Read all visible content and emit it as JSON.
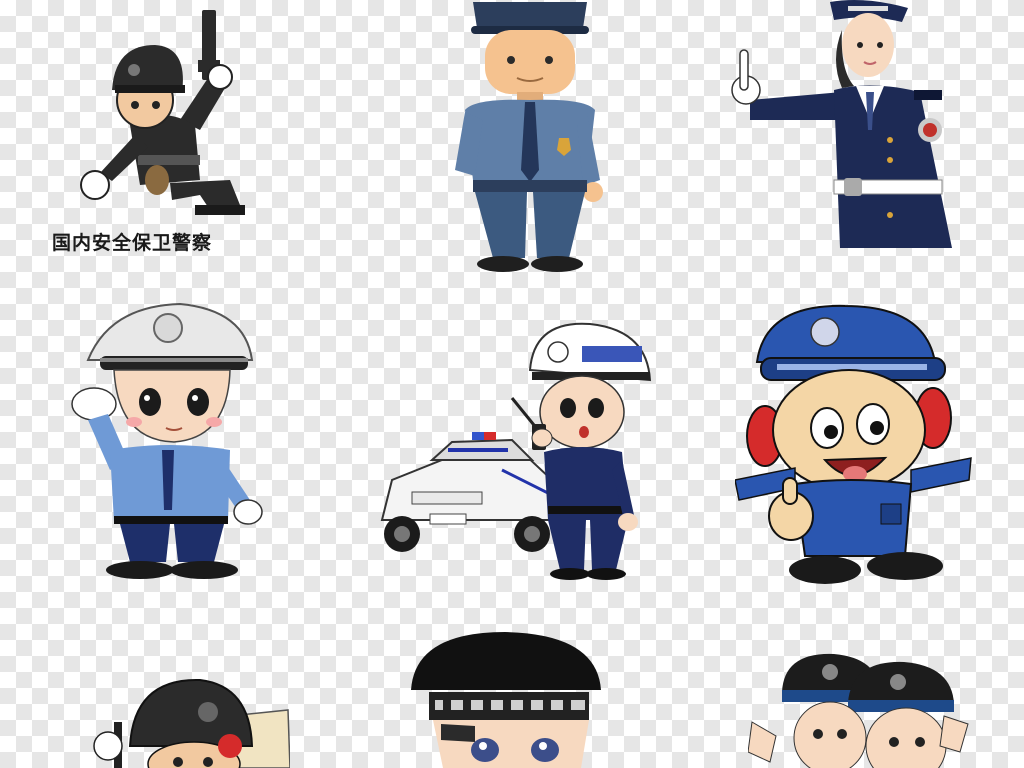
{
  "caption": "国内安全保卫警察",
  "figures": [
    {
      "name": "helmet-officer-with-gun",
      "colors": {
        "uniform": "#2b2b2b",
        "skin": "#f2c9a0"
      }
    },
    {
      "name": "blue-uniform-officer",
      "colors": {
        "uniform": "#5f7fa8",
        "pants": "#3c5a80",
        "cap": "#2c3e5c"
      }
    },
    {
      "name": "female-officer-pointing",
      "colors": {
        "uniform": "#1d2a55",
        "belt": "#ffffff"
      }
    },
    {
      "name": "saluting-officer-white-cap",
      "colors": {
        "cap": "#e8e8e8",
        "shirt": "#6f9ad6",
        "pants": "#1e2f6a"
      }
    },
    {
      "name": "traffic-officer-with-car",
      "colors": {
        "helmet": "#ffffff",
        "uniform": "#1f2d66",
        "car": "#f4f4f4"
      }
    },
    {
      "name": "thumbs-up-mascot",
      "colors": {
        "cap": "#2a56b0",
        "body": "#2a56b0",
        "headphones": "#d52b2b"
      }
    },
    {
      "name": "officer-with-map",
      "colors": {
        "helmet": "#2b2b2b",
        "map": "#f1e4c2"
      }
    },
    {
      "name": "black-cap-officer",
      "colors": {
        "cap": "#111111",
        "band": "#333333"
      }
    },
    {
      "name": "two-female-officers",
      "colors": {
        "cap": "#1c1c1c",
        "band": "#1e4a8a"
      }
    }
  ]
}
